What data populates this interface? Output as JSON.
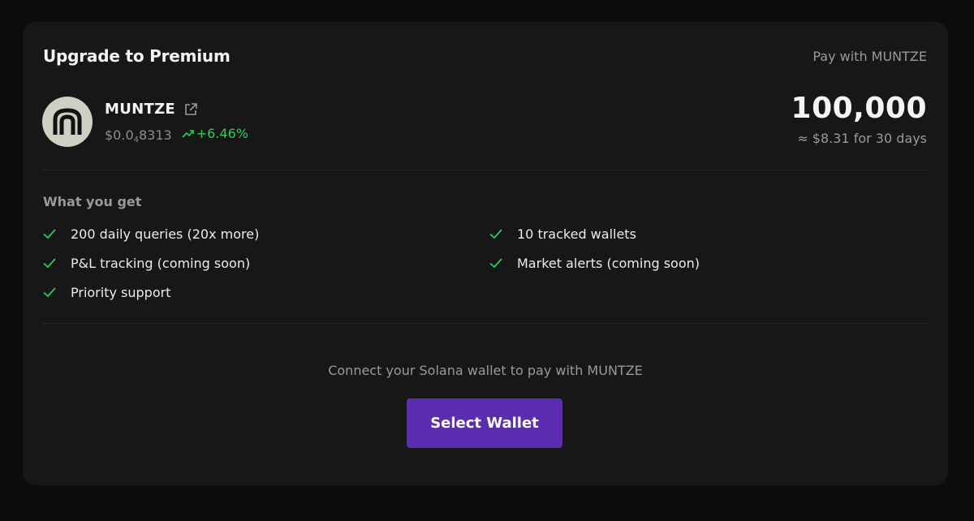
{
  "header": {
    "title": "Upgrade to Premium",
    "pay_with": "Pay with MUNTZE"
  },
  "token": {
    "logo_icon": "muntze-logo-icon",
    "name": "MUNTZE",
    "price_prefix": "$0.0",
    "price_zeros": "4",
    "price_digits": "8313",
    "change": "+6.46%",
    "change_icon": "trending-up-icon",
    "link_icon": "external-link-icon"
  },
  "pricing": {
    "amount": "100,000",
    "approx": "≈ $8.31 for 30 days"
  },
  "features": {
    "title": "What you get",
    "items": [
      "200 daily queries (20x more)",
      "10 tracked wallets",
      "P&L tracking (coming soon)",
      "Market alerts (coming soon)",
      "Priority support"
    ]
  },
  "connect": {
    "text": "Connect your Solana wallet to pay with MUNTZE",
    "button_label": "Select Wallet"
  },
  "colors": {
    "background": "#0c0c0c",
    "card": "#171717",
    "accent": "#5b2db0",
    "positive": "#2ecc5a",
    "muted": "#9a9a9a"
  }
}
